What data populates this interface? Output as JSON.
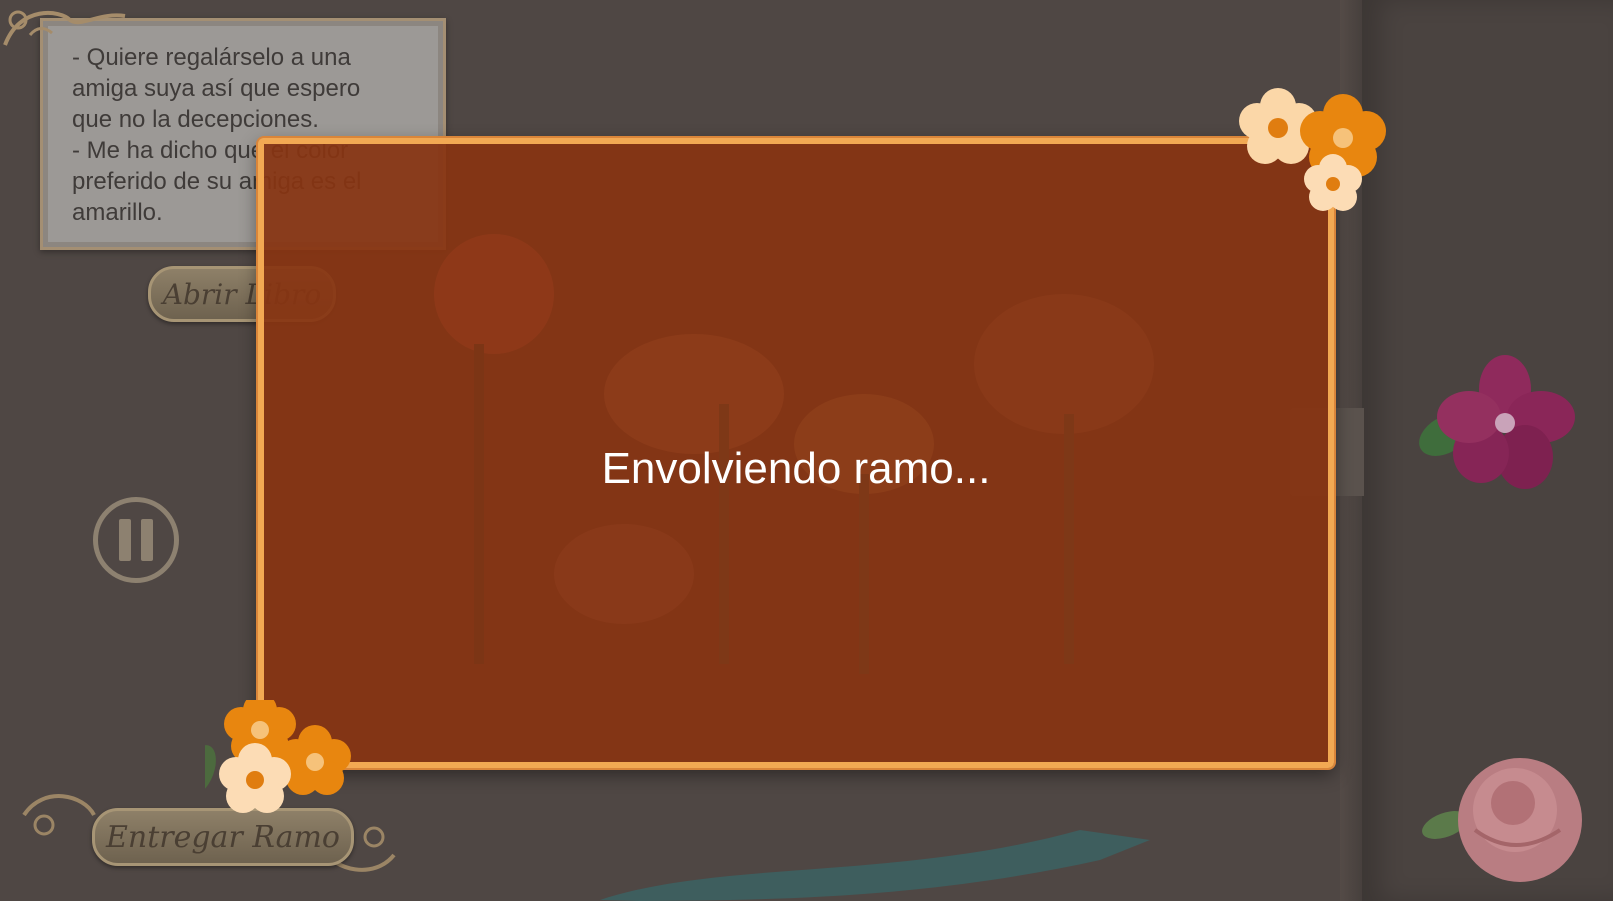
{
  "note": {
    "text": "- Quiere regalárselo a una\namiga suya así que espero\nque no la decepciones.\n- Me ha dicho que el color\npreferido de su amiga es el\namarillo."
  },
  "buttons": {
    "open_book": "Abrir Libro",
    "deliver_bouquet": "Entregar Ramo"
  },
  "modal": {
    "message": "Envolviendo ramo..."
  },
  "colors": {
    "modal_fill": "#883411",
    "modal_border": "#f2a953",
    "background": "#4f4744"
  },
  "icons": [
    "pause-icon",
    "flower-cluster-icon",
    "magenta-flower-icon",
    "pink-rose-icon"
  ]
}
